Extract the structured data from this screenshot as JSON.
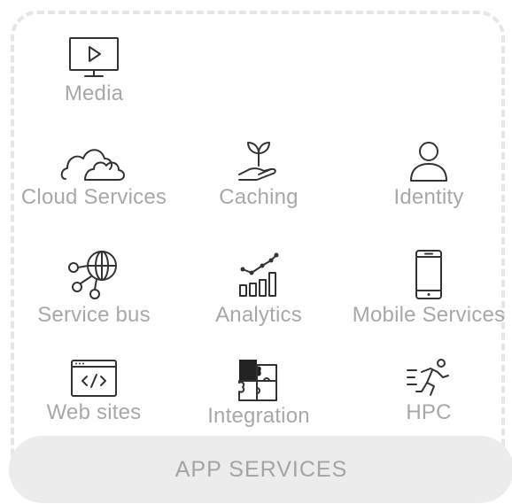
{
  "services": {
    "media": {
      "label": "Media",
      "icon": "monitor-play-icon"
    },
    "cloud": {
      "label": "Cloud Services",
      "icon": "clouds-icon"
    },
    "caching": {
      "label": "Caching",
      "icon": "hand-plant-icon"
    },
    "identity": {
      "label": "Identity",
      "icon": "user-icon"
    },
    "service_bus": {
      "label": "Service bus",
      "icon": "globe-network-icon"
    },
    "analytics": {
      "label": "Analytics",
      "icon": "bar-chart-trend-icon"
    },
    "mobile": {
      "label": "Mobile Services",
      "icon": "smartphone-icon"
    },
    "web": {
      "label": "Web sites",
      "icon": "code-window-icon"
    },
    "integration": {
      "label": "Integration",
      "icon": "puzzle-icon"
    },
    "hpc": {
      "label": "HPC",
      "icon": "running-person-icon"
    }
  },
  "footer": {
    "label": "APP SERVICES"
  },
  "colors": {
    "icon": "#333333",
    "label": "#a8a8a8",
    "footer_bg": "#ececec",
    "frame": "#e6e6e6"
  }
}
